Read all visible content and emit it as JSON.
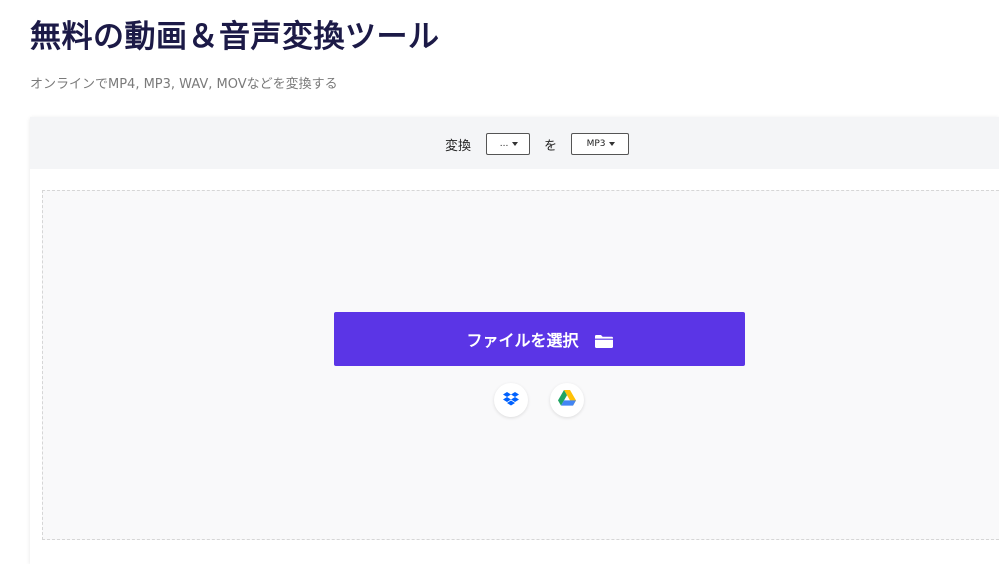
{
  "header": {
    "title": "無料の動画＆音声変換ツール",
    "subtitle": "オンラインでMP4, MP3, WAV, MOVなどを変換する"
  },
  "converter": {
    "convert_label": "変換",
    "from_value": "...",
    "to_label": "を",
    "to_value": "MP3"
  },
  "upload": {
    "choose_button_label": "ファイルを選択",
    "choose_button_icon": "folder-icon",
    "cloud_sources": [
      {
        "name": "dropbox",
        "icon": "dropbox-icon",
        "color": "#0061fe"
      },
      {
        "name": "google-drive",
        "icon": "google-drive-icon",
        "color": "#1fa463"
      }
    ]
  },
  "colors": {
    "accent": "#5b35e6",
    "title": "#1c1a47",
    "subtitle": "#7a7a7a",
    "panel_header_bg": "#f4f5f7",
    "dropzone_bg": "#f9f9fa"
  }
}
